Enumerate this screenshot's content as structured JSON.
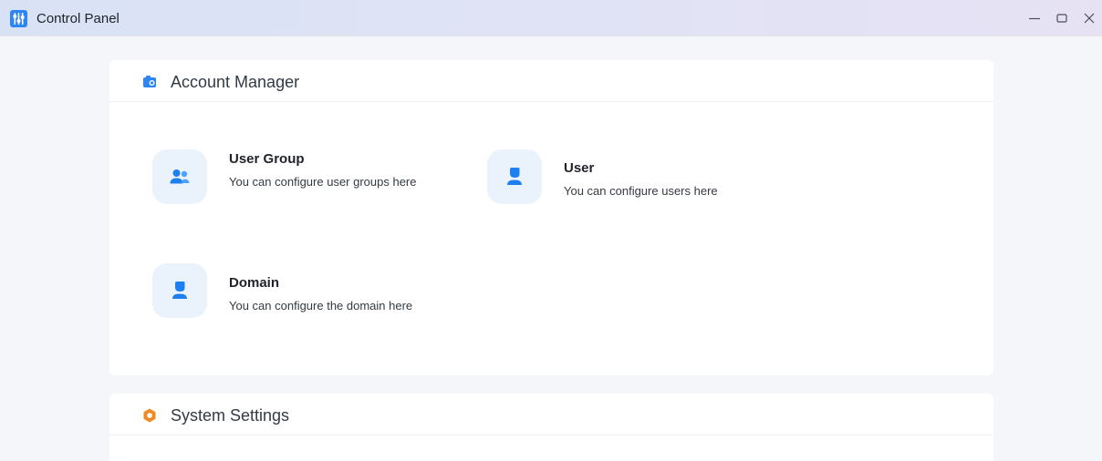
{
  "window": {
    "title": "Control Panel",
    "icon": "control-panel-icon",
    "controls": [
      "minimize-icon",
      "maximize-icon",
      "close-icon"
    ],
    "accent_color": "#2e86f5"
  },
  "account_manager": {
    "title": "Account Manager",
    "icon": "account-manager-icon",
    "items": [
      {
        "title": "User Group",
        "description": "You can configure user groups here",
        "icon": "user-group-icon"
      },
      {
        "title": "User",
        "description": "You can configure users here",
        "icon": "user-icon"
      },
      {
        "title": "Domain",
        "description": "You can configure the domain here",
        "icon": "domain-icon"
      }
    ]
  },
  "system_settings": {
    "title": "System Settings",
    "icon": "system-settings-gear-icon",
    "accent_color": "#f08a24"
  }
}
